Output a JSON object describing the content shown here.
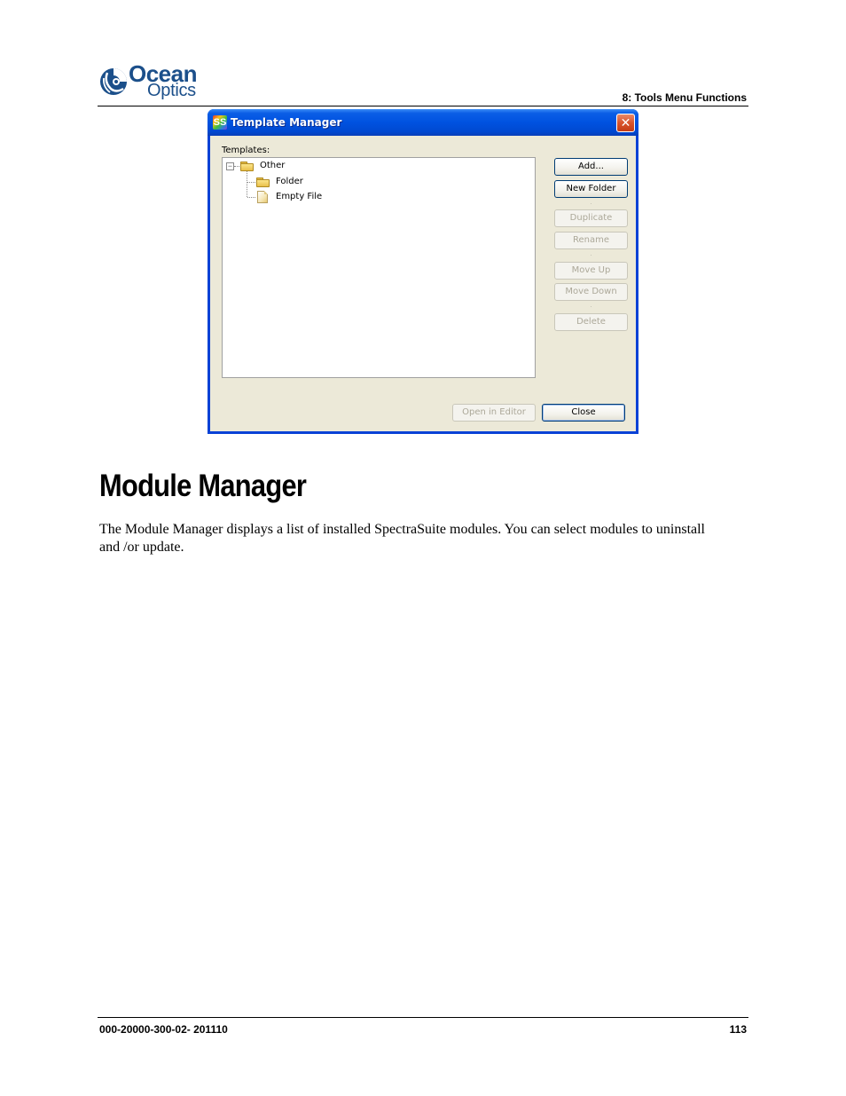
{
  "header": {
    "logo": {
      "line1": "Ocean",
      "line2": "Optics",
      "icon": "ocean-optics-swirl-icon",
      "brand_color": "#1b4f8a"
    },
    "chapter": "8: Tools Menu Functions"
  },
  "dialog": {
    "title": "Template Manager",
    "app_icon": "spectrasuite-icon",
    "app_icon_text": "SS",
    "close_icon": "close-x-icon",
    "close_glyph": "✕",
    "templates_label": "Templates:",
    "tree": {
      "root": {
        "label": "Other",
        "icon": "folder-icon",
        "expanded": true,
        "expander_glyph": "−"
      },
      "children": [
        {
          "label": "Folder",
          "icon": "folder-icon"
        },
        {
          "label": "Empty File",
          "icon": "file-icon"
        }
      ]
    },
    "side_buttons": [
      {
        "label": "Add...",
        "enabled": true
      },
      {
        "label": "New Folder",
        "enabled": true
      },
      {
        "label": "Duplicate",
        "enabled": false
      },
      {
        "label": "Rename",
        "enabled": false
      },
      {
        "label": "Move Up",
        "enabled": false
      },
      {
        "label": "Move Down",
        "enabled": false
      },
      {
        "label": "Delete",
        "enabled": false
      }
    ],
    "bottom_buttons": [
      {
        "label": "Open in Editor",
        "enabled": false
      },
      {
        "label": "Close",
        "enabled": true,
        "default": true
      }
    ],
    "colors": {
      "title_bar": "#0052e0",
      "client_bg": "#ece9d8",
      "close_button": "#d9542c"
    }
  },
  "section": {
    "heading": "Module Manager",
    "paragraph": "The Module Manager displays a list of installed SpectraSuite modules. You can select modules to uninstall and /or update."
  },
  "footer": {
    "doc_number": "000-20000-300-02- 201110",
    "page_number": "113"
  }
}
